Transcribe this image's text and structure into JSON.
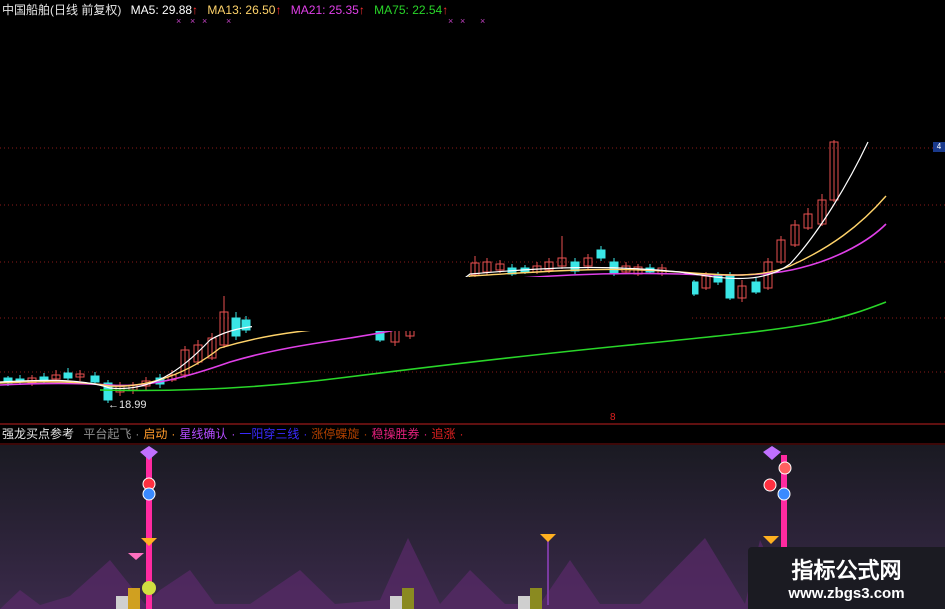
{
  "header": {
    "stock": "中国船舶(日线 前复权)",
    "ma5": "MA5: 29.88",
    "ma13": "MA13: 26.50",
    "ma21": "MA21: 25.35",
    "ma75": "MA75: 22.54",
    "arrow": "↑"
  },
  "colors": {
    "ma5": "#ffffff",
    "ma13": "#ffd36a",
    "ma21": "#e040e8",
    "ma75": "#29d629",
    "up": "#e85050",
    "down": "#3ae6e6",
    "grid": "#8a1a1a"
  },
  "chart": {
    "low_label": "←18.99",
    "marker": "8",
    "axis_tag": "4"
  },
  "indicator": {
    "title": "强龙买点参考",
    "labels": [
      {
        "text": "平台起飞",
        "color": "#8f8f8f"
      },
      {
        "text": "启动",
        "color": "#ff9a2a"
      },
      {
        "text": "星线确认",
        "color": "#b44cff"
      },
      {
        "text": "一阳穿三线",
        "color": "#3a2aff"
      },
      {
        "text": "涨停蝶旋",
        "color": "#b04000"
      },
      {
        "text": "稳操胜券",
        "color": "#e0207a"
      },
      {
        "text": "追涨",
        "color": "#e02020"
      }
    ],
    "sep": "·"
  },
  "watermark": {
    "title": "指标公式网",
    "url": "www.zbgs3.com"
  }
}
